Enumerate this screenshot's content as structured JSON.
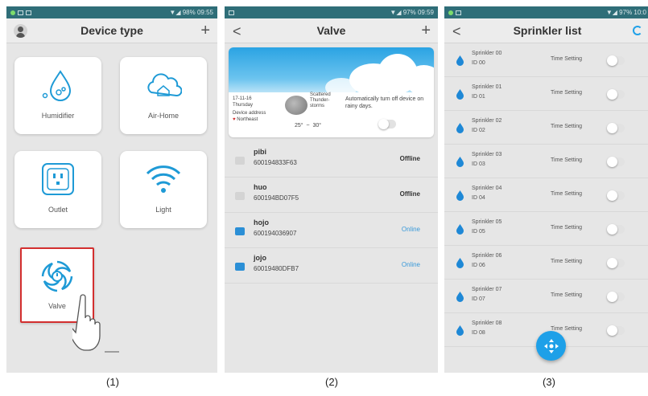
{
  "screen1": {
    "status_time": "09:55",
    "status_battery": "98%",
    "title": "Device type",
    "add_icon": "+",
    "cards": [
      {
        "label": "Humidifier",
        "icon": "droplet-icon"
      },
      {
        "label": "Air-Home",
        "icon": "cloud-home-icon"
      },
      {
        "label": "Outlet",
        "icon": "outlet-icon"
      },
      {
        "label": "Light",
        "icon": "wifi-light-icon"
      },
      {
        "label": "Valve",
        "icon": "valve-icon"
      }
    ],
    "caption": "(1)"
  },
  "screen2": {
    "status_time": "09:59",
    "status_battery": "97%",
    "title": "Valve",
    "back_icon": "<",
    "add_icon": "+",
    "banner": {
      "date": "17-11-16",
      "day": "Thursday",
      "address_label": "Device address",
      "location": "Northeast",
      "weather": "Scattered Thunder-storms",
      "temp_low": "25°",
      "temp_sep": "~",
      "temp_high": "30°",
      "auto_text": "Automatically turn off device on rainy days."
    },
    "devices": [
      {
        "name": "pibi",
        "id": "600194833F63",
        "status": "Offline",
        "online": false
      },
      {
        "name": "huo",
        "id": "600194BD07F5",
        "status": "Offline",
        "online": false
      },
      {
        "name": "hojo",
        "id": "600194036907",
        "status": "Online",
        "online": true
      },
      {
        "name": "jojo",
        "id": "60019480DFB7",
        "status": "Online",
        "online": true
      }
    ],
    "caption": "(2)"
  },
  "screen3": {
    "status_time": "10:0",
    "status_battery": "97%",
    "title": "Sprinkler list",
    "back_icon": "<",
    "time_setting_label": "Time Setting",
    "sprinklers": [
      {
        "name": "Sprinkler 00",
        "id": "ID 00"
      },
      {
        "name": "Sprinkler 01",
        "id": "ID 01"
      },
      {
        "name": "Sprinkler 02",
        "id": "ID 02"
      },
      {
        "name": "Sprinkler 03",
        "id": "ID 03"
      },
      {
        "name": "Sprinkler 04",
        "id": "ID 04"
      },
      {
        "name": "Sprinkler 05",
        "id": "ID 05"
      },
      {
        "name": "Sprinkler 06",
        "id": "ID 06"
      },
      {
        "name": "Sprinkler 07",
        "id": "ID 07"
      },
      {
        "name": "Sprinkler 08",
        "id": "ID 08"
      }
    ],
    "caption": "(3)"
  },
  "colors": {
    "status_bar": "#2f6e78",
    "accent": "#1ea0e8",
    "highlight": "#d32f2f",
    "online": "#3a9ad9",
    "offline": "#333333"
  }
}
